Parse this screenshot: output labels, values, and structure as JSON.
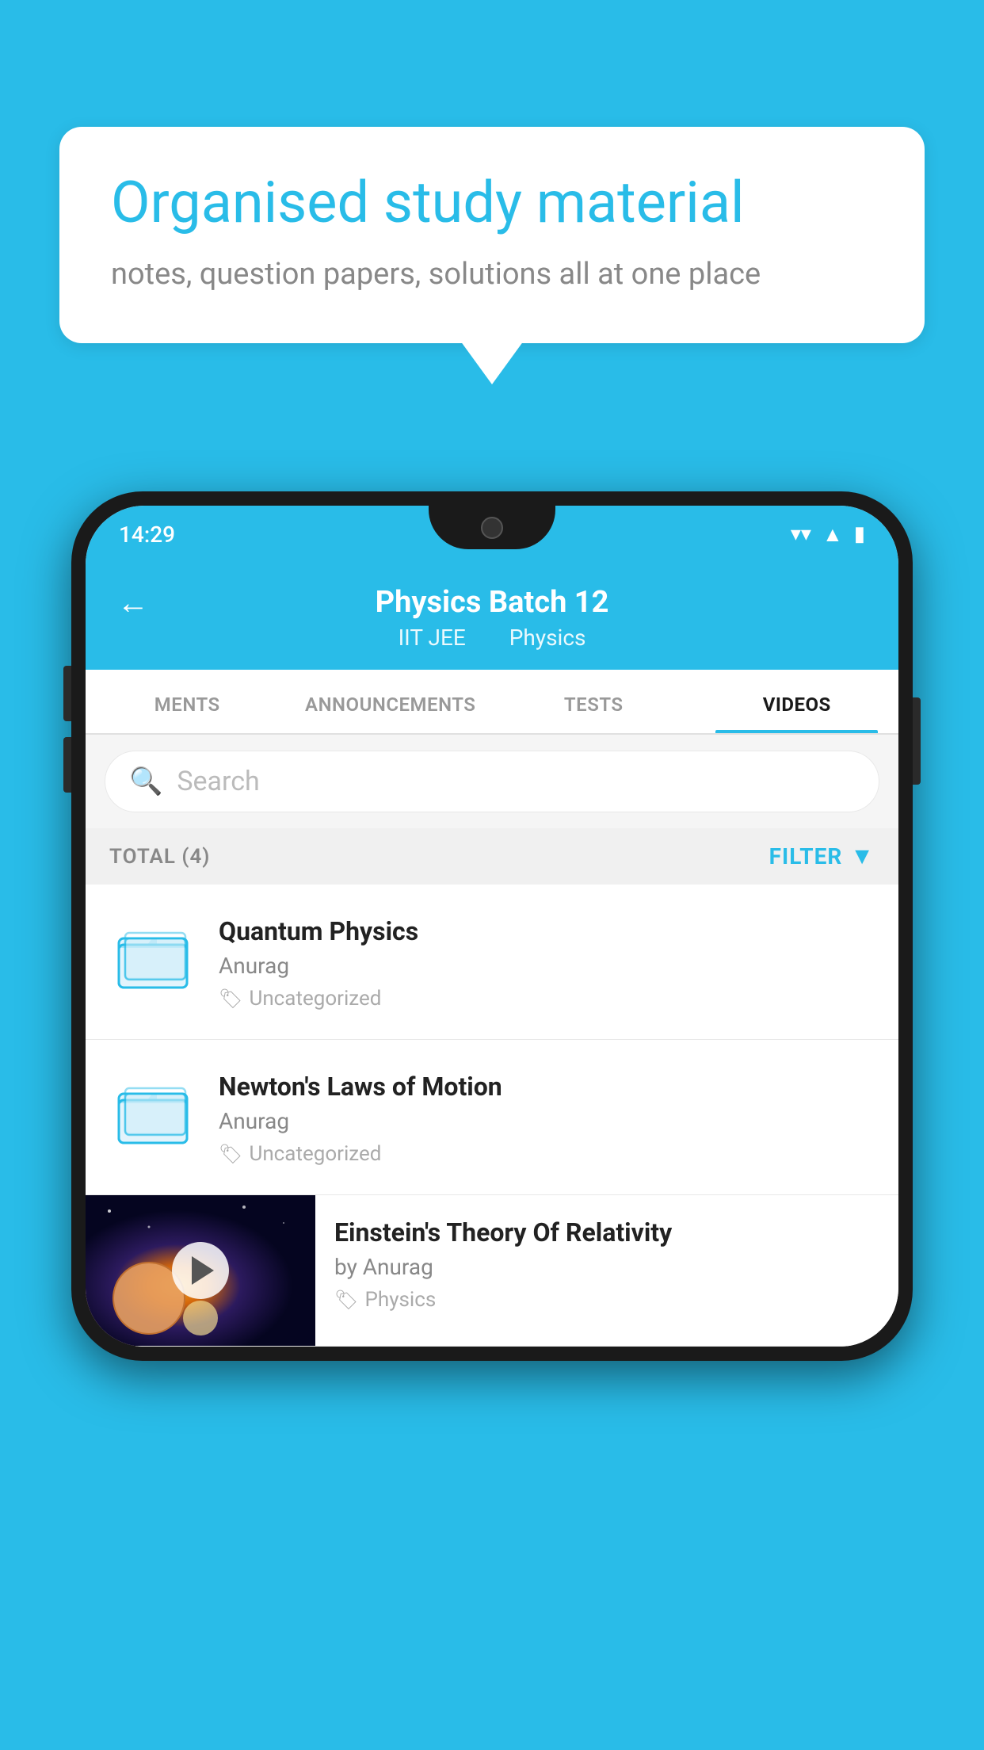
{
  "background": {
    "color": "#29bce8"
  },
  "speech_bubble": {
    "title": "Organised study material",
    "subtitle": "notes, question papers, solutions all at one place"
  },
  "phone": {
    "status_bar": {
      "time": "14:29"
    },
    "header": {
      "title": "Physics Batch 12",
      "subtitle_part1": "IIT JEE",
      "subtitle_part2": "Physics",
      "back_label": "←"
    },
    "tabs": [
      {
        "label": "MENTS",
        "active": false
      },
      {
        "label": "ANNOUNCEMENTS",
        "active": false
      },
      {
        "label": "TESTS",
        "active": false
      },
      {
        "label": "VIDEOS",
        "active": true
      }
    ],
    "search": {
      "placeholder": "Search"
    },
    "filter_bar": {
      "total_label": "TOTAL (4)",
      "filter_label": "FILTER"
    },
    "videos": [
      {
        "id": "1",
        "title": "Quantum Physics",
        "author": "Anurag",
        "tag": "Uncategorized",
        "type": "folder"
      },
      {
        "id": "2",
        "title": "Newton's Laws of Motion",
        "author": "Anurag",
        "tag": "Uncategorized",
        "type": "folder"
      },
      {
        "id": "3",
        "title": "Einstein's Theory Of Relativity",
        "author": "by Anurag",
        "tag": "Physics",
        "type": "video"
      }
    ]
  }
}
